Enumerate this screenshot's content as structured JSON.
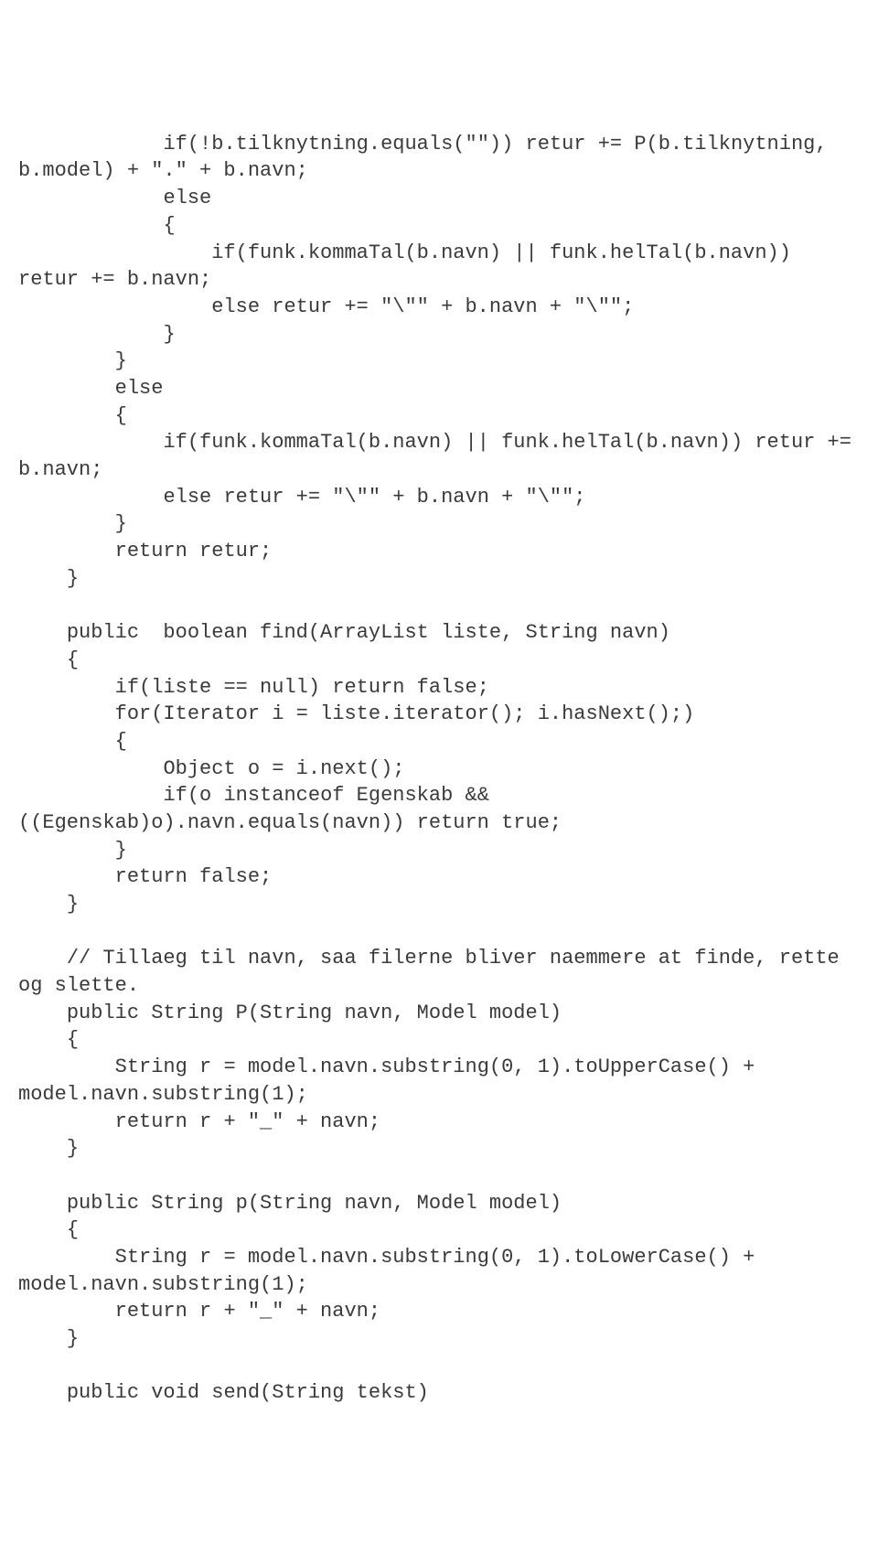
{
  "code": "            if(!b.tilknytning.equals(\"\")) retur += P(b.tilknytning, b.model) + \".\" + b.navn;\n            else\n            {\n                if(funk.kommaTal(b.navn) || funk.helTal(b.navn)) retur += b.navn;\n                else retur += \"\\\"\" + b.navn + \"\\\"\";\n            }\n        }\n        else\n        {\n            if(funk.kommaTal(b.navn) || funk.helTal(b.navn)) retur += b.navn;\n            else retur += \"\\\"\" + b.navn + \"\\\"\";\n        }\n        return retur;\n    }\n\n    public  boolean find(ArrayList liste, String navn)\n    {\n        if(liste == null) return false;\n        for(Iterator i = liste.iterator(); i.hasNext();)\n        {\n            Object o = i.next();\n            if(o instanceof Egenskab && ((Egenskab)o).navn.equals(navn)) return true;\n        }\n        return false;\n    }\n\n    // Tillaeg til navn, saa filerne bliver naemmere at finde, rette og slette.\n    public String P(String navn, Model model)\n    {\n        String r = model.navn.substring(0, 1).toUpperCase() + model.navn.substring(1);\n        return r + \"_\" + navn;\n    }\n\n    public String p(String navn, Model model)\n    {\n        String r = model.navn.substring(0, 1).toLowerCase() + model.navn.substring(1);\n        return r + \"_\" + navn;\n    }\n\n    public void send(String tekst)"
}
